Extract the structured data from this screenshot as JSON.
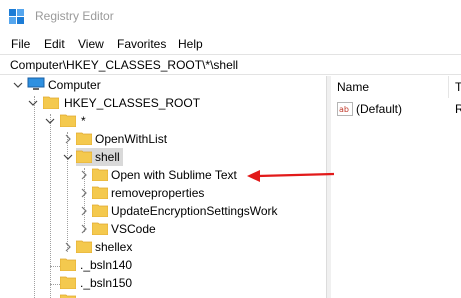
{
  "window": {
    "title": "Registry Editor"
  },
  "menu": [
    "File",
    "Edit",
    "View",
    "Favorites",
    "Help"
  ],
  "address": "Computer\\HKEY_CLASSES_ROOT\\*\\shell",
  "tree": {
    "computer": "Computer",
    "hkcr": "HKEY_CLASSES_ROOT",
    "star": "*",
    "openwithlist": "OpenWithList",
    "shell": "shell",
    "shell_children": [
      "Open with Sublime Text",
      "removeproperties",
      "UpdateEncryptionSettingsWork",
      "VSCode"
    ],
    "shellex": "shellex",
    "bsln140": "._bsln140",
    "bsln150": "._bsln150"
  },
  "list": {
    "col_name": "Name",
    "col_type": "T",
    "value_name": "(Default)",
    "value_type": "R"
  },
  "colors": {
    "folder": "#f4c94e",
    "folder_dark": "#e0a82e",
    "selection": "#d9d9d9",
    "arrow": "#e21a1a"
  },
  "icons": [
    "registry-editor-icon",
    "computer-icon",
    "folder-icon",
    "string-value-icon",
    "chevron-down-icon",
    "chevron-right-icon",
    "red-arrow"
  ]
}
